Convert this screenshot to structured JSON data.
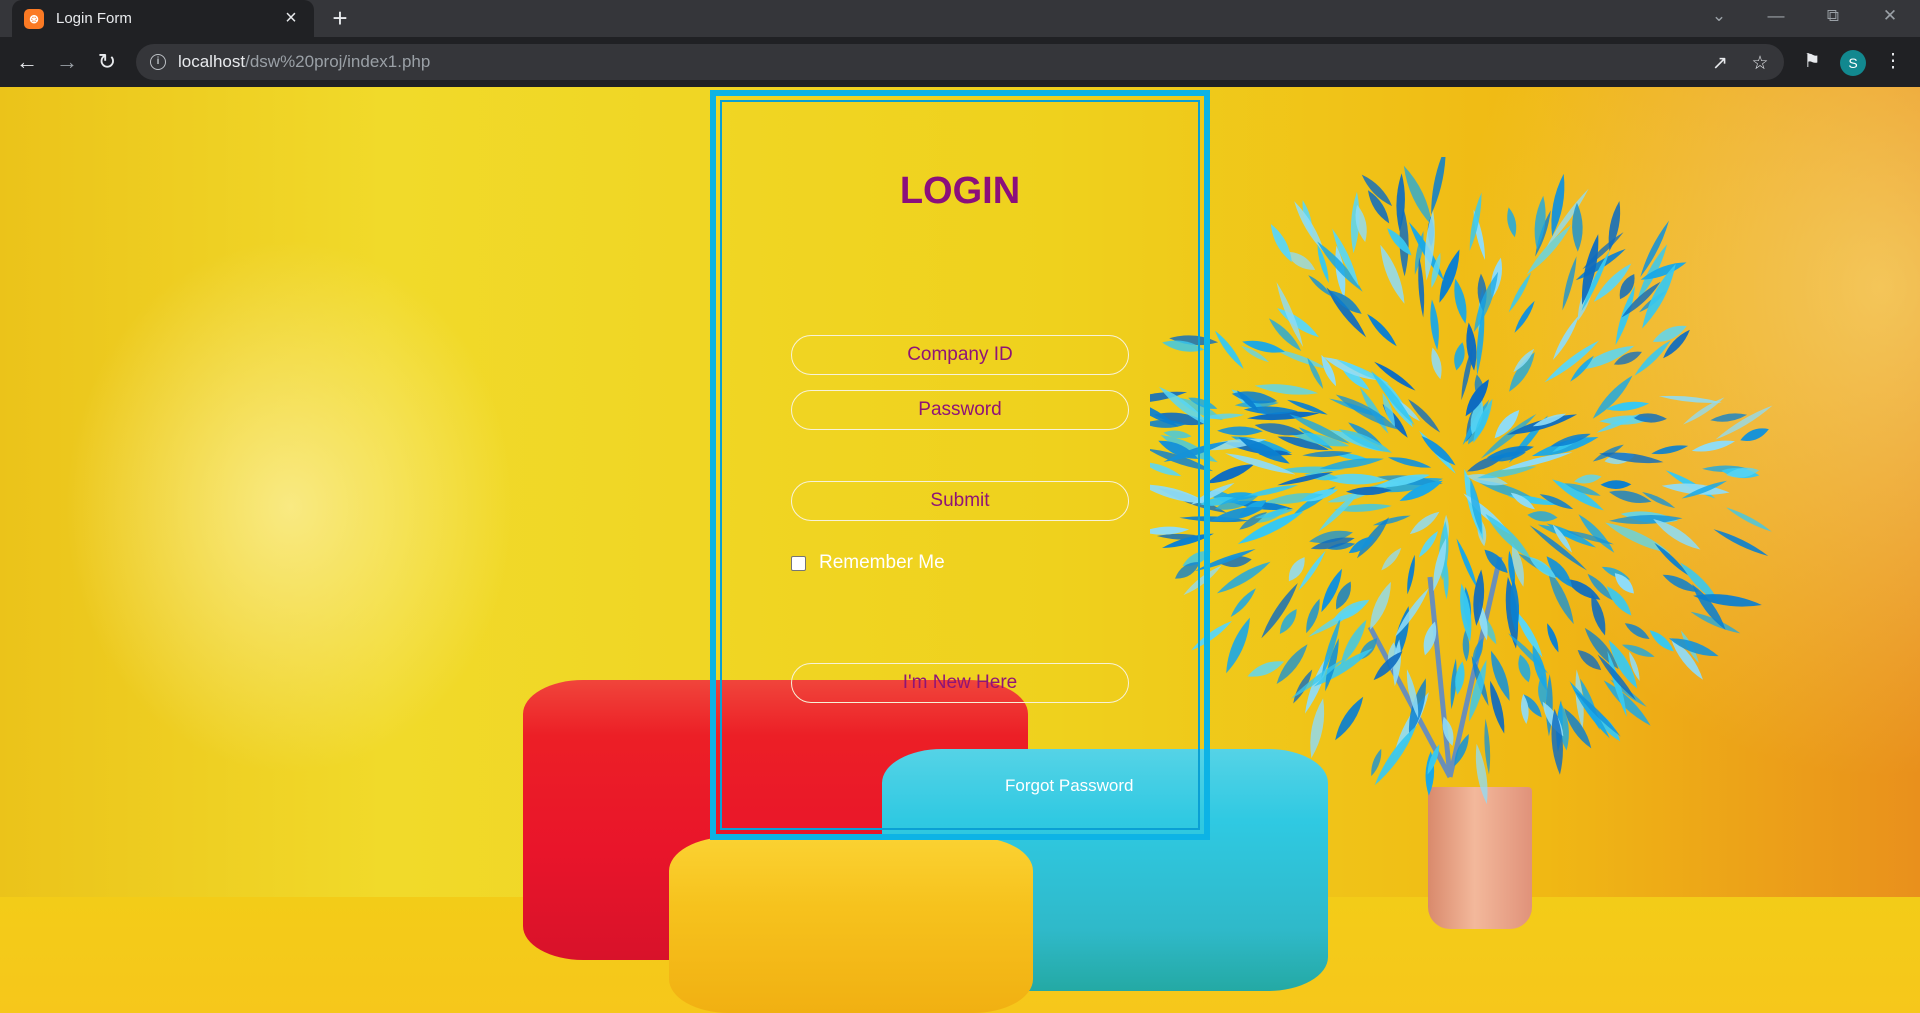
{
  "browser": {
    "tab": {
      "title": "Login Form",
      "favicon": "xampp-icon"
    },
    "url": {
      "host": "localhost",
      "path": "/dsw%20proj/index1.php"
    },
    "profile_initial": "S"
  },
  "login": {
    "title": "LOGIN",
    "company_id_placeholder": "Company ID",
    "password_placeholder": "Password",
    "submit_label": "Submit",
    "remember_label": "Remember Me",
    "new_here_label": "I'm New Here",
    "forgot_label": "Forgot Password"
  },
  "colors": {
    "frame": "#0db3e5",
    "title": "#8b0f7c",
    "pill_text": "#8f1477",
    "background": "#f1d41e"
  }
}
